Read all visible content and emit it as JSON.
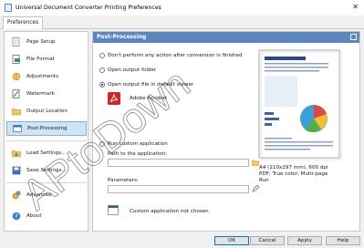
{
  "window": {
    "title": "Universal Document Converter Printing Preferences",
    "close_glyph": "✕"
  },
  "tabs": [
    {
      "label": "Preferences"
    }
  ],
  "sidebar": {
    "items": [
      {
        "label": "Page Setup",
        "icon": "page-setup-icon"
      },
      {
        "label": "File Format",
        "icon": "file-format-icon"
      },
      {
        "label": "Adjustments",
        "icon": "adjustments-icon"
      },
      {
        "label": "Watermark",
        "icon": "watermark-icon"
      },
      {
        "label": "Output Location",
        "icon": "folder-icon"
      },
      {
        "label": "Post-Processing",
        "icon": "post-processing-icon",
        "selected": true
      },
      {
        "label": "Load Settings...",
        "icon": "load-settings-icon"
      },
      {
        "label": "Save Settings...",
        "icon": "save-settings-icon"
      },
      {
        "label": "Advanced",
        "icon": "advanced-icon"
      },
      {
        "label": "About",
        "icon": "about-icon"
      }
    ]
  },
  "panel": {
    "title": "Post-Processing",
    "options": {
      "none": "Don't perform any action after conversion is finished",
      "open_folder": "Open output folder",
      "open_viewer": "Open output file in default viewer",
      "run_custom": "Run custom application"
    },
    "selected_option": "open_viewer",
    "viewer_app": "Adobe Acrobat",
    "path_label": "Path to the application:",
    "path_value": "",
    "params_label": "Parameters:",
    "params_value": "",
    "custom_app_status": "Custom application not chosen"
  },
  "preview": {
    "info_line1": "A4 (210x297 mm), 600 dpi",
    "info_line2": "PDF; True color; Multi-page",
    "info_line3": "Run"
  },
  "buttons": {
    "ok": "OK",
    "cancel": "Cancel",
    "apply": "Apply",
    "help": "Help"
  },
  "watermark_text": "APtoDown",
  "colors": {
    "header_blue": "#5b87c1",
    "selection": "#cfe3f7",
    "acrobat_red": "#d2232a"
  }
}
